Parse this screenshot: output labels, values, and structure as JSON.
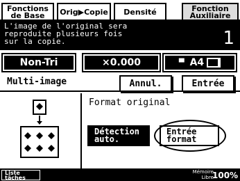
{
  "tabs": [
    {
      "line1": "Fonctions",
      "line2": "de Base",
      "active": false
    },
    {
      "label": "Orig▶Copie",
      "active": false
    },
    {
      "label": "Densité",
      "active": false
    },
    {
      "line1": "Fonction",
      "line2": "Auxiliaire",
      "active": true
    }
  ],
  "message": {
    "lines": [
      "L'image de l'original sera",
      "reproduite plusieurs fois",
      "sur la copie."
    ],
    "copy_count": "1"
  },
  "status": {
    "mode": "Non-Tri",
    "zoom": "×0.000",
    "paper": "A4"
  },
  "function": {
    "title": "Multi-image",
    "cancel_label": "Annul.",
    "enter_label": "Entrée"
  },
  "format": {
    "label": "Format original",
    "auto_line1": "Détection",
    "auto_line2": "auto.",
    "manual_line1": "Entrée",
    "manual_line2": "format"
  },
  "footer": {
    "tasks_line1": "Liste",
    "tasks_line2": "tâches",
    "memory_line1": "Mémoire",
    "memory_line2": "Libre",
    "memory_value": "100%"
  }
}
